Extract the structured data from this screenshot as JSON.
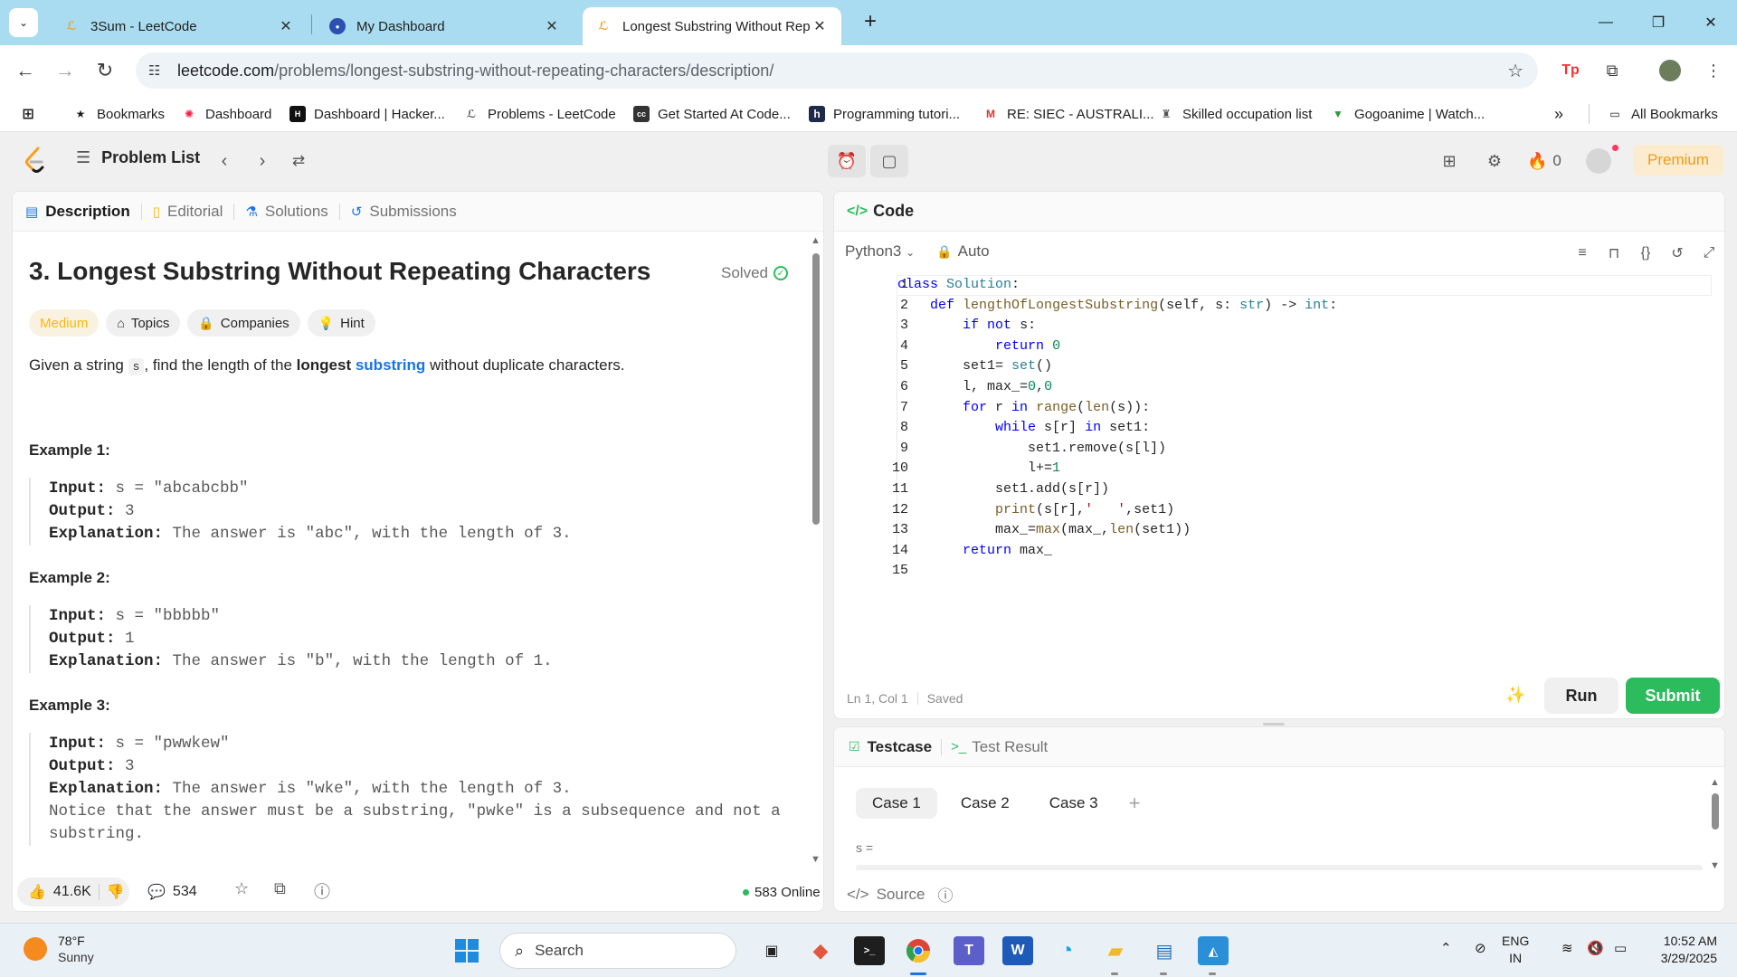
{
  "browser": {
    "tabs": [
      {
        "title": "3Sum - LeetCode",
        "icon": "leetcode-icon"
      },
      {
        "title": "My Dashboard",
        "icon": "shield-icon"
      },
      {
        "title": "Longest Substring Without Rep",
        "icon": "leetcode-icon",
        "active": true
      }
    ],
    "url_host": "leetcode.com",
    "url_path": "/problems/longest-substring-without-repeating-characters/description/",
    "bookmarks": [
      {
        "label": "Bookmarks"
      },
      {
        "label": "Dashboard"
      },
      {
        "label": "Dashboard | Hacker..."
      },
      {
        "label": "Problems - LeetCode"
      },
      {
        "label": "Get Started At Code..."
      },
      {
        "label": "Programming tutori..."
      },
      {
        "label": "RE: SIEC - AUSTRALI..."
      },
      {
        "label": "Skilled occupation list"
      },
      {
        "label": "Gogoanime | Watch..."
      }
    ],
    "all_bookmarks": "All Bookmarks"
  },
  "lc_nav": {
    "problem_list": "Problem List",
    "streak": "0",
    "premium": "Premium"
  },
  "left": {
    "tabs": [
      "Description",
      "Editorial",
      "Solutions",
      "Submissions"
    ],
    "title": "3. Longest Substring Without Repeating Characters",
    "solved": "Solved",
    "difficulty": "Medium",
    "chips": [
      "Topics",
      "Companies",
      "Hint"
    ],
    "desc": {
      "p1": "Given a string ",
      "code": "s",
      "p2": ", find the length of the ",
      "bold": "longest",
      "link": "substring",
      "p3": " without duplicate characters."
    },
    "examples": [
      {
        "heading": "Example 1:",
        "input": "s = \"abcabcbb\"",
        "output": "3",
        "explanation": "The answer is \"abc\", with the length of 3."
      },
      {
        "heading": "Example 2:",
        "input": "s = \"bbbbb\"",
        "output": "1",
        "explanation": "The answer is \"b\", with the length of 1."
      },
      {
        "heading": "Example 3:",
        "input": "s = \"pwwkew\"",
        "output": "3",
        "explanation": "The answer is \"wke\", with the length of 3.",
        "note1": "Notice that the answer must be a substring, \"pwke\" is a subsequence and not a",
        "note2": "substring."
      }
    ],
    "labels": {
      "input": "Input:",
      "output": "Output:",
      "explanation": "Explanation:"
    },
    "footer": {
      "likes": "41.6K",
      "comments": "534",
      "online": "583 Online"
    }
  },
  "code": {
    "header": "Code",
    "language": "Python3",
    "mode": "Auto",
    "status_pos": "Ln 1, Col 1",
    "status_saved": "Saved",
    "run": "Run",
    "submit": "Submit"
  },
  "test": {
    "tab_testcase": "Testcase",
    "tab_result": "Test Result",
    "cases": [
      "Case 1",
      "Case 2",
      "Case 3"
    ],
    "add": "+",
    "var_label": "s =",
    "source": "Source"
  },
  "taskbar": {
    "temp": "78°F",
    "cond": "Sunny",
    "search": "Search",
    "lang1": "ENG",
    "lang2": "IN",
    "time": "10:52 AM",
    "date": "3/29/2025"
  }
}
